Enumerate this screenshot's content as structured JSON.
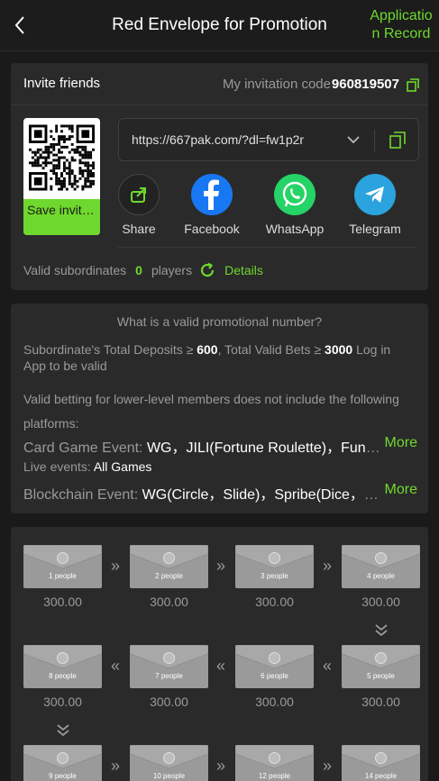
{
  "header": {
    "title": "Red Envelope for Promotion",
    "record_link": "Application Record"
  },
  "invite": {
    "title": "Invite friends",
    "code_label": "My invitation code",
    "code_value": "960819507",
    "save_label": "Save invitation...",
    "link": "https://667pak.com/?dl=fw1p2r",
    "share_options": [
      {
        "label": "Share",
        "icon": "share-icon",
        "color": "#2a2a2a"
      },
      {
        "label": "Facebook",
        "icon": "facebook-icon",
        "color": "#1877f2"
      },
      {
        "label": "WhatsApp",
        "icon": "whatsapp-icon",
        "color": "#25d366"
      },
      {
        "label": "Telegram",
        "icon": "telegram-icon",
        "color": "#2aa3df"
      }
    ],
    "valid_label": "Valid subordinates",
    "valid_count": "0",
    "valid_unit": "players",
    "details_label": "Details"
  },
  "rules": {
    "question": "What is a valid promotional number?",
    "deposit_prefix": "Subordinate's Total Deposits ≥",
    "deposit_value": "600",
    "bets_prefix": ",  Total Valid Bets ≥",
    "bets_value": "3000",
    "bets_suffix": " Log in App to be valid",
    "exclusion": "Valid betting for lower-level members does not include the following platforms:",
    "card_event_label": "Card Game Event:",
    "card_event_value": "WG，JILI(Fortune Roulette)，Funky Games",
    "live_event_label": "Live events:",
    "live_event_value": "All Games",
    "blockchain_event_label": "Blockchain Event:",
    "blockchain_event_value": "WG(Circle，Slide)，Spribe(Dice，Mines)",
    "more_label": "More"
  },
  "envelopes": [
    {
      "people": "1 people",
      "amount": "300.00"
    },
    {
      "people": "2 people",
      "amount": "300.00"
    },
    {
      "people": "3 people",
      "amount": "300.00"
    },
    {
      "people": "4 people",
      "amount": "300.00"
    },
    {
      "people": "5 people",
      "amount": "300.00"
    },
    {
      "people": "6 people",
      "amount": "300.00"
    },
    {
      "people": "7 people",
      "amount": "300.00"
    },
    {
      "people": "8 people",
      "amount": "300.00"
    },
    {
      "people": "9 people",
      "amount": ""
    },
    {
      "people": "10 people",
      "amount": ""
    },
    {
      "people": "12 people",
      "amount": ""
    },
    {
      "people": "14 people",
      "amount": ""
    }
  ],
  "colors": {
    "accent": "#6fd82e",
    "background": "#1a1a1a",
    "card": "#2a2a2a"
  }
}
